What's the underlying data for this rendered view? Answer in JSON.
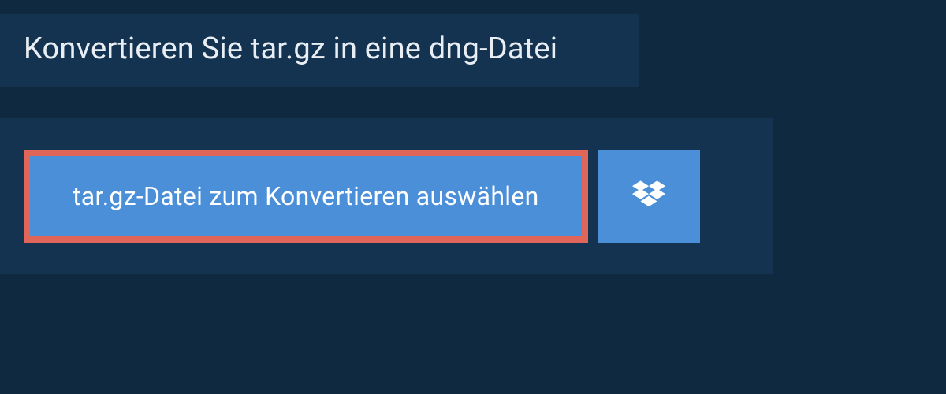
{
  "header": {
    "title": "Konvertieren Sie tar.gz in eine dng-Datei"
  },
  "actions": {
    "select_file_label": "tar.gz-Datei zum Konvertieren auswählen"
  },
  "colors": {
    "page_bg": "#0f2940",
    "panel_bg": "#143351",
    "button_bg": "#4a8fd8",
    "highlight_border": "#e0665a",
    "text_light": "#e8eef3"
  }
}
